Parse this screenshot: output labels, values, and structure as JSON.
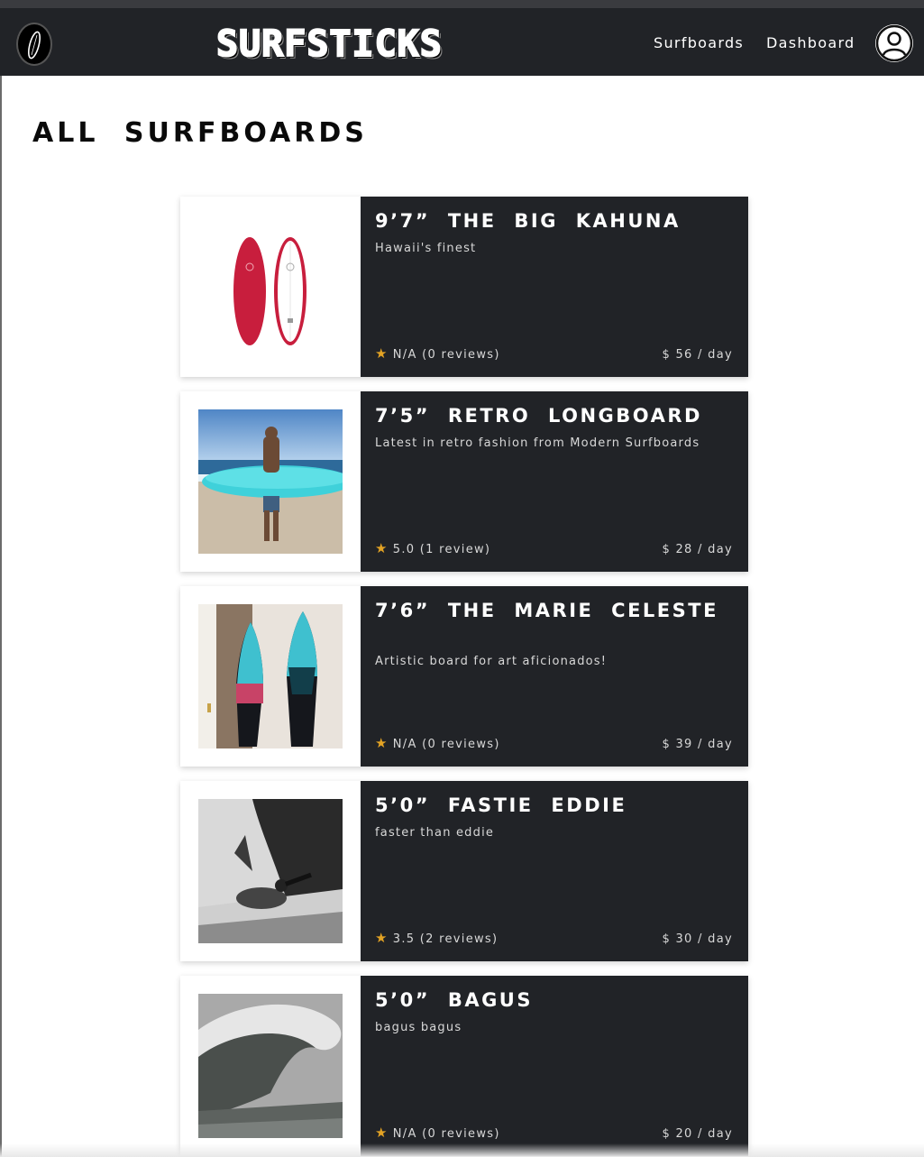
{
  "app": {
    "brand": "SURFSTICKS",
    "logo_icon": "surfboard-icon",
    "nav": [
      {
        "label": "Surfboards"
      },
      {
        "label": "Dashboard"
      }
    ],
    "avatar_icon": "user-avatar-icon"
  },
  "page": {
    "title": "ALL SURFBOARDS"
  },
  "listings": [
    {
      "title": "9’7” THE BIG KAHUNA",
      "description": "Hawaii's finest",
      "rating": "N/A (0 reviews)",
      "price": "$ 56 / day",
      "image": "red-surfboards-photo"
    },
    {
      "title": "7’5” RETRO LONGBOARD",
      "description": "Latest in retro fashion from Modern Surfboards",
      "rating": "5.0 (1 review)",
      "price": "$ 28 / day",
      "image": "beach-surfer-photo"
    },
    {
      "title": "7’6” THE MARIE CELESTE",
      "description": "Artistic board for art aficionados!",
      "rating": "N/A (0 reviews)",
      "price": "$ 39 / day",
      "image": "artistic-boards-photo"
    },
    {
      "title": "5’0” FASTIE EDDIE",
      "description": "faster than eddie",
      "rating": "3.5 (2 reviews)",
      "price": "$ 30 / day",
      "image": "skater-bw-photo"
    },
    {
      "title": "5’0” BAGUS",
      "description": "bagus bagus",
      "rating": "N/A (0 reviews)",
      "price": "$ 20 / day",
      "image": "big-wave-photo"
    }
  ],
  "colors": {
    "navbar": "#212327",
    "card": "#212327",
    "star": "#e3a324"
  }
}
